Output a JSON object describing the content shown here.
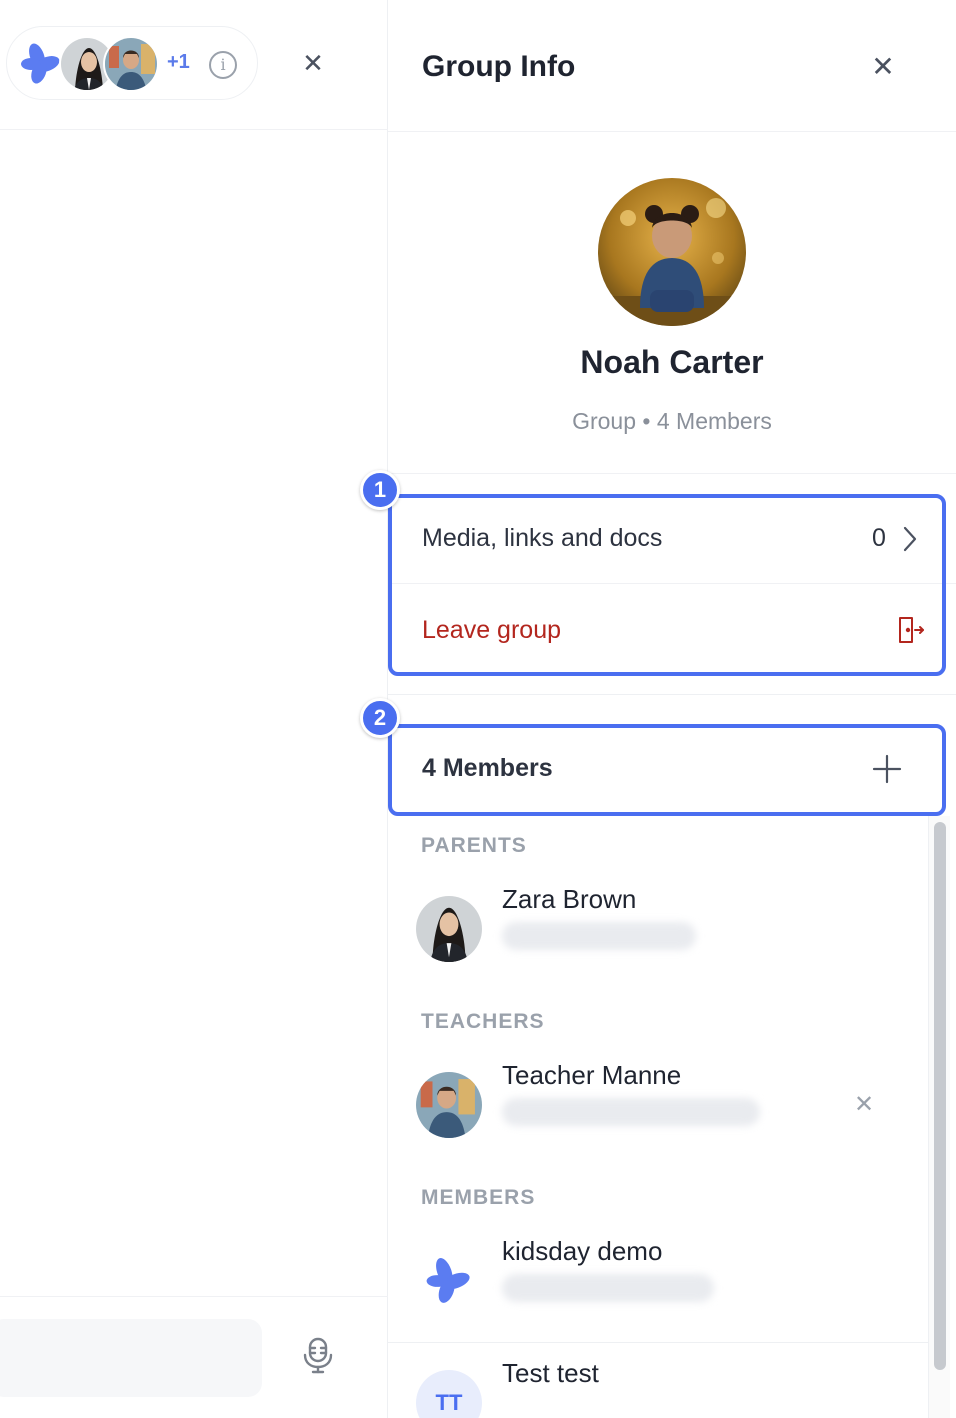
{
  "left_pane": {
    "avatar_pill": {
      "extra_count": "+1",
      "avatars": [
        "kidsday-logo",
        "zara-brown-photo",
        "teacher-manne-photo"
      ],
      "info_icon": "info-icon"
    },
    "close_icon": "close-icon",
    "mic_icon": "microphone-icon"
  },
  "group_info": {
    "title": "Group Info",
    "close_icon": "close-icon",
    "profile": {
      "name": "Noah Carter",
      "subtitle": "Group • 4 Members"
    },
    "actions": {
      "media_label": "Media, links and docs",
      "media_count": "0",
      "leave_label": "Leave group"
    },
    "members_header": {
      "label": "4 Members",
      "add_icon": "plus-icon"
    },
    "sections": {
      "parents": "PARENTS",
      "teachers": "TEACHERS",
      "members": "MEMBERS"
    },
    "members": {
      "parent_1": {
        "name": "Zara Brown"
      },
      "teacher_1": {
        "name": "Teacher Manne"
      },
      "member_1": {
        "name": "kidsday demo"
      },
      "member_2": {
        "name": "Test test",
        "initials": "TT"
      }
    },
    "annotations": [
      "1",
      "2"
    ]
  },
  "colors": {
    "accent": "#4a6ef0",
    "danger": "#b3261e",
    "muted": "#8a909a"
  }
}
